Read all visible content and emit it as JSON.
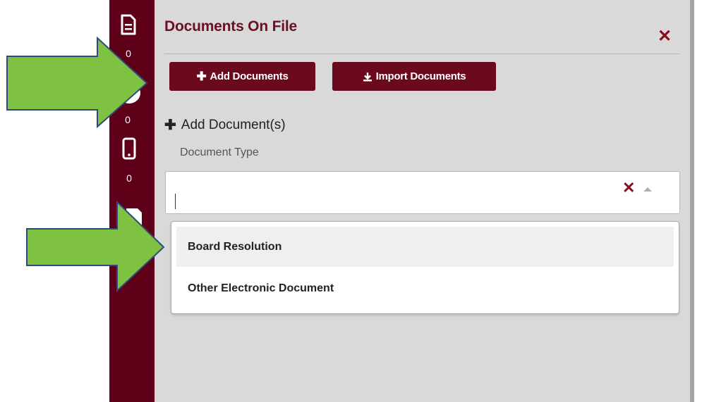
{
  "sidebar": {
    "items": [
      {
        "icon": "document-icon",
        "count": "0"
      },
      {
        "icon": "chat-bubble-icon",
        "count": "0"
      },
      {
        "icon": "mobile-phone-icon",
        "count": "0"
      },
      {
        "icon": "folder-icon",
        "count": ""
      }
    ]
  },
  "panel": {
    "title": "Documents On File",
    "buttons": {
      "add_label": "Add Documents",
      "import_label": "Import Documents"
    },
    "section_title": "Add Document(s)",
    "document_type_label": "Document Type",
    "select": {
      "value": "",
      "options": [
        "Board Resolution",
        "Other Electronic Document"
      ],
      "highlighted_index": 0
    }
  },
  "colors": {
    "brand_maroon": "#5e0017",
    "button_maroon": "#6b0a1c",
    "title_maroon": "#6b0f22",
    "panel_gray": "#d9d9d9",
    "arrow_green": "#7fc241",
    "arrow_outline": "#2e4a7a"
  }
}
